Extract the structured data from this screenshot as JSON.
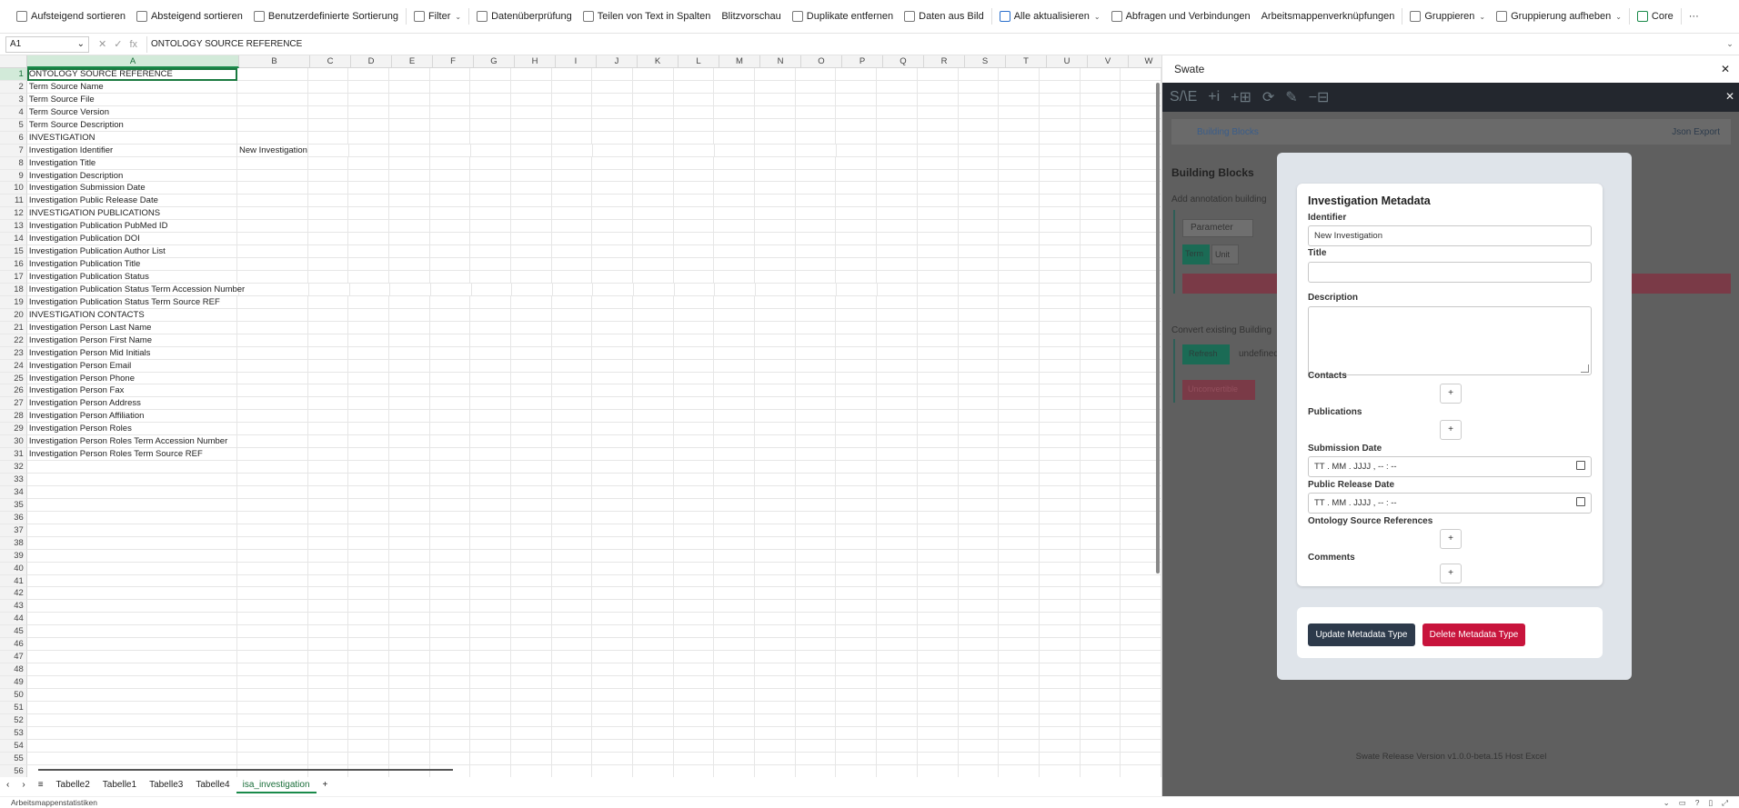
{
  "ribbon": {
    "items": [
      {
        "label": "Aufsteigend sortieren",
        "icon": "sort-asc-icon"
      },
      {
        "label": "Absteigend sortieren",
        "icon": "sort-desc-icon"
      },
      {
        "label": "Benutzerdefinierte Sortierung",
        "icon": "custom-sort-icon"
      },
      {
        "label": "Filter",
        "icon": "filter-icon"
      },
      {
        "label": "Datenüberprüfung",
        "icon": "data-validation-icon"
      },
      {
        "label": "Teilen von Text in Spalten",
        "icon": "text-to-columns-icon"
      },
      {
        "label": "Blitzvorschau",
        "icon": ""
      },
      {
        "label": "Duplikate entfernen",
        "icon": "remove-duplicates-icon"
      },
      {
        "label": "Daten aus Bild",
        "icon": "data-from-picture-icon"
      },
      {
        "label": "Alle aktualisieren",
        "icon": "refresh-all-icon"
      },
      {
        "label": "Abfragen und Verbindungen",
        "icon": "queries-icon"
      },
      {
        "label": "Arbeitsmappenverknüpfungen",
        "icon": ""
      },
      {
        "label": "Gruppieren",
        "icon": "group-icon"
      },
      {
        "label": "Gruppierung aufheben",
        "icon": "ungroup-icon"
      },
      {
        "label": "Core",
        "icon": "swate-s-icon"
      },
      {
        "label": "···",
        "icon": ""
      }
    ]
  },
  "formula_bar": {
    "cell_ref": "A1",
    "formula": "ONTOLOGY SOURCE REFERENCE",
    "fx": "fx"
  },
  "sheet": {
    "columns": [
      "A",
      "B",
      "C",
      "D",
      "E",
      "F",
      "G",
      "H",
      "I",
      "J",
      "K",
      "L",
      "M",
      "N",
      "O",
      "P",
      "Q",
      "R",
      "S",
      "T",
      "U",
      "V",
      "W"
    ],
    "row_count": 56,
    "col_a": [
      "ONTOLOGY SOURCE REFERENCE",
      "Term Source Name",
      "Term Source File",
      "Term Source Version",
      "Term Source Description",
      "INVESTIGATION",
      "Investigation Identifier",
      "Investigation Title",
      "Investigation Description",
      "Investigation Submission Date",
      "Investigation Public Release Date",
      "INVESTIGATION PUBLICATIONS",
      "Investigation Publication PubMed ID",
      "Investigation Publication DOI",
      "Investigation Publication Author List",
      "Investigation Publication Title",
      "Investigation Publication Status",
      "Investigation Publication Status Term Accession Number",
      "Investigation Publication Status Term Source REF",
      "INVESTIGATION CONTACTS",
      "Investigation Person Last Name",
      "Investigation Person First Name",
      "Investigation Person Mid Initials",
      "Investigation Person Email",
      "Investigation Person Phone",
      "Investigation Person Fax",
      "Investigation Person Address",
      "Investigation Person Affiliation",
      "Investigation Person Roles",
      "Investigation Person Roles Term Accession Number",
      "Investigation Person Roles Term Source REF"
    ],
    "col_b": {
      "7": "New Investigation"
    }
  },
  "sheet_tabs": [
    "Tabelle2",
    "Tabelle1",
    "Tabelle3",
    "Tabelle4",
    "isa_investigation"
  ],
  "active_tab": "isa_investigation",
  "status_bar": {
    "left": "Arbeitsmappenstatistiken"
  },
  "pane": {
    "title": "Swate",
    "tabs": {
      "left": "Building Blocks",
      "right": "Json Export"
    },
    "building_blocks_title": "Building Blocks",
    "add_text": "Add annotation building",
    "parameter_label": "Parameter",
    "term_label": "Term",
    "unit_label": "Unit",
    "convert_text": "Convert existing Building",
    "refresh_label": "Refresh",
    "undefined_label": "undefined",
    "unconvertible_label": "Unconvertible",
    "unc_trunc": "unc",
    "footer": "Swate Release Version v1.0.0-beta.15 Host Excel"
  },
  "modal": {
    "title": "Investigation Metadata",
    "identifier_label": "Identifier",
    "identifier_value": "New Investigation",
    "title_label": "Title",
    "description_label": "Description",
    "contacts_label": "Contacts",
    "publications_label": "Publications",
    "submission_label": "Submission Date",
    "submission_placeholder": "TT . MM . JJJJ ,  -- : --",
    "release_label": "Public Release Date",
    "release_placeholder": "TT . MM . JJJJ ,  -- : --",
    "osr_label": "Ontology Source References",
    "comments_label": "Comments",
    "plus": "+",
    "update_button": "Update Metadata Type",
    "delete_button": "Delete Metadata Type"
  },
  "colors": {
    "accent": "#1a8a4a",
    "primary_button": "#2d3a4b",
    "danger_button": "#c8143c"
  }
}
